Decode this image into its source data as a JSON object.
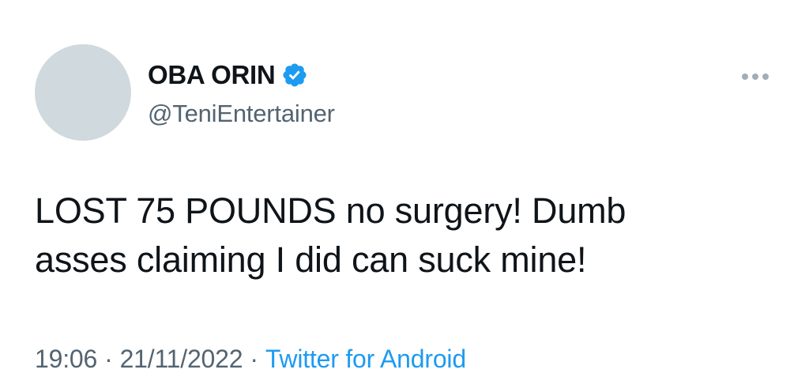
{
  "tweet": {
    "display_name": "OBA ORIN",
    "handle": "@TeniEntertainer",
    "verified": true,
    "text_line1": "LOST 75 POUNDS no surgery! Dumb",
    "text_line2": "asses claiming I did can suck mine!",
    "time": "19:06",
    "date": "21/11/2022",
    "separator": "·",
    "source": "Twitter for Android"
  },
  "icons": {
    "verified": "verified-badge-icon",
    "more": "more-options-icon"
  },
  "colors": {
    "verified_blue": "#1d9bf0",
    "link_blue": "#1d9bf0",
    "secondary_text": "#536471",
    "avatar_placeholder": "#cfd9de"
  }
}
